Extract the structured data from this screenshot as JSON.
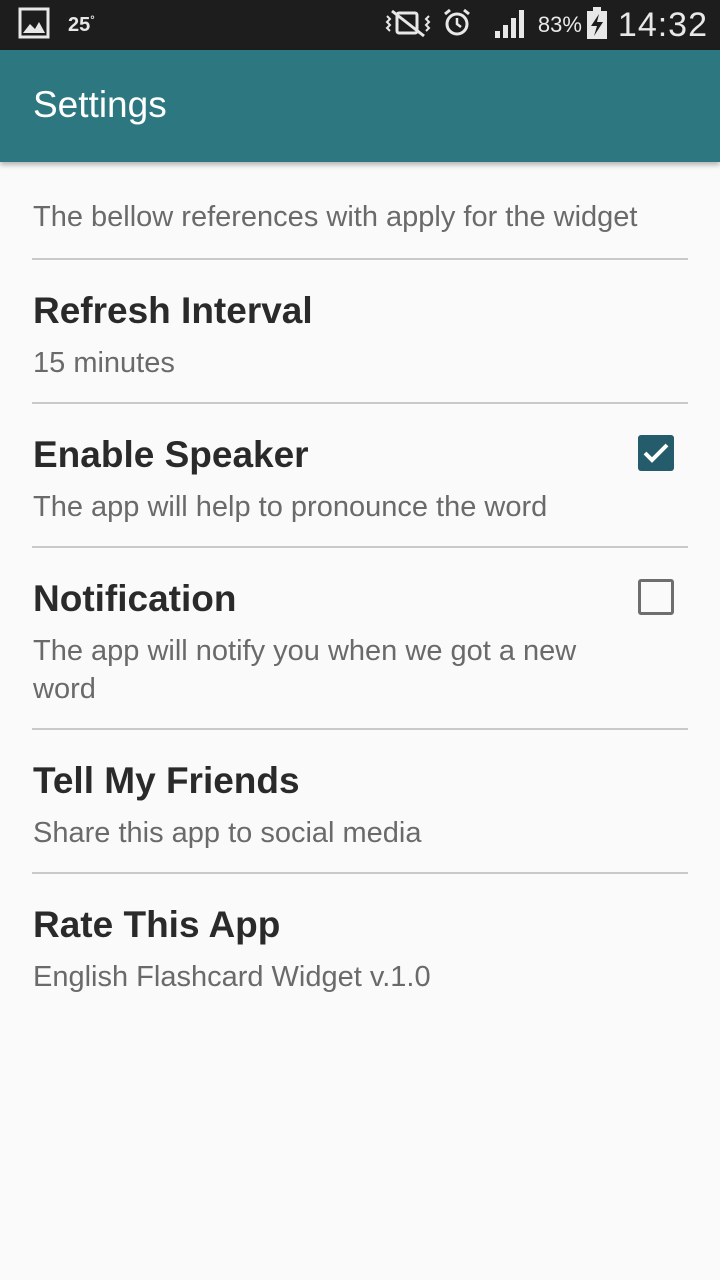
{
  "status_bar": {
    "temperature": "25",
    "temperature_unit": "°",
    "battery_percent": "83%",
    "time": "14:32",
    "icons": [
      "gallery-icon",
      "mute-vibrate-icon",
      "alarm-icon",
      "signal-icon",
      "battery-charging-icon"
    ]
  },
  "toolbar": {
    "title": "Settings"
  },
  "intro_text": "The bellow references with apply for the widget",
  "preferences": [
    {
      "title": "Refresh Interval",
      "summary": "15 minutes"
    },
    {
      "title": "Enable Speaker",
      "summary": "The app will help to pronounce the word",
      "checked": true
    },
    {
      "title": "Notification",
      "summary": "The app will notify you when we got a new word",
      "checked": false
    },
    {
      "title": "Tell My Friends",
      "summary": "Share this app to social media"
    },
    {
      "title": "Rate This App",
      "summary": "English Flashcard Widget v.1.0"
    }
  ],
  "colors": {
    "toolbar": "#2d7880",
    "status_bar": "#1d1d1d",
    "checkbox_checked": "#255c6b",
    "background": "#fafafa"
  }
}
